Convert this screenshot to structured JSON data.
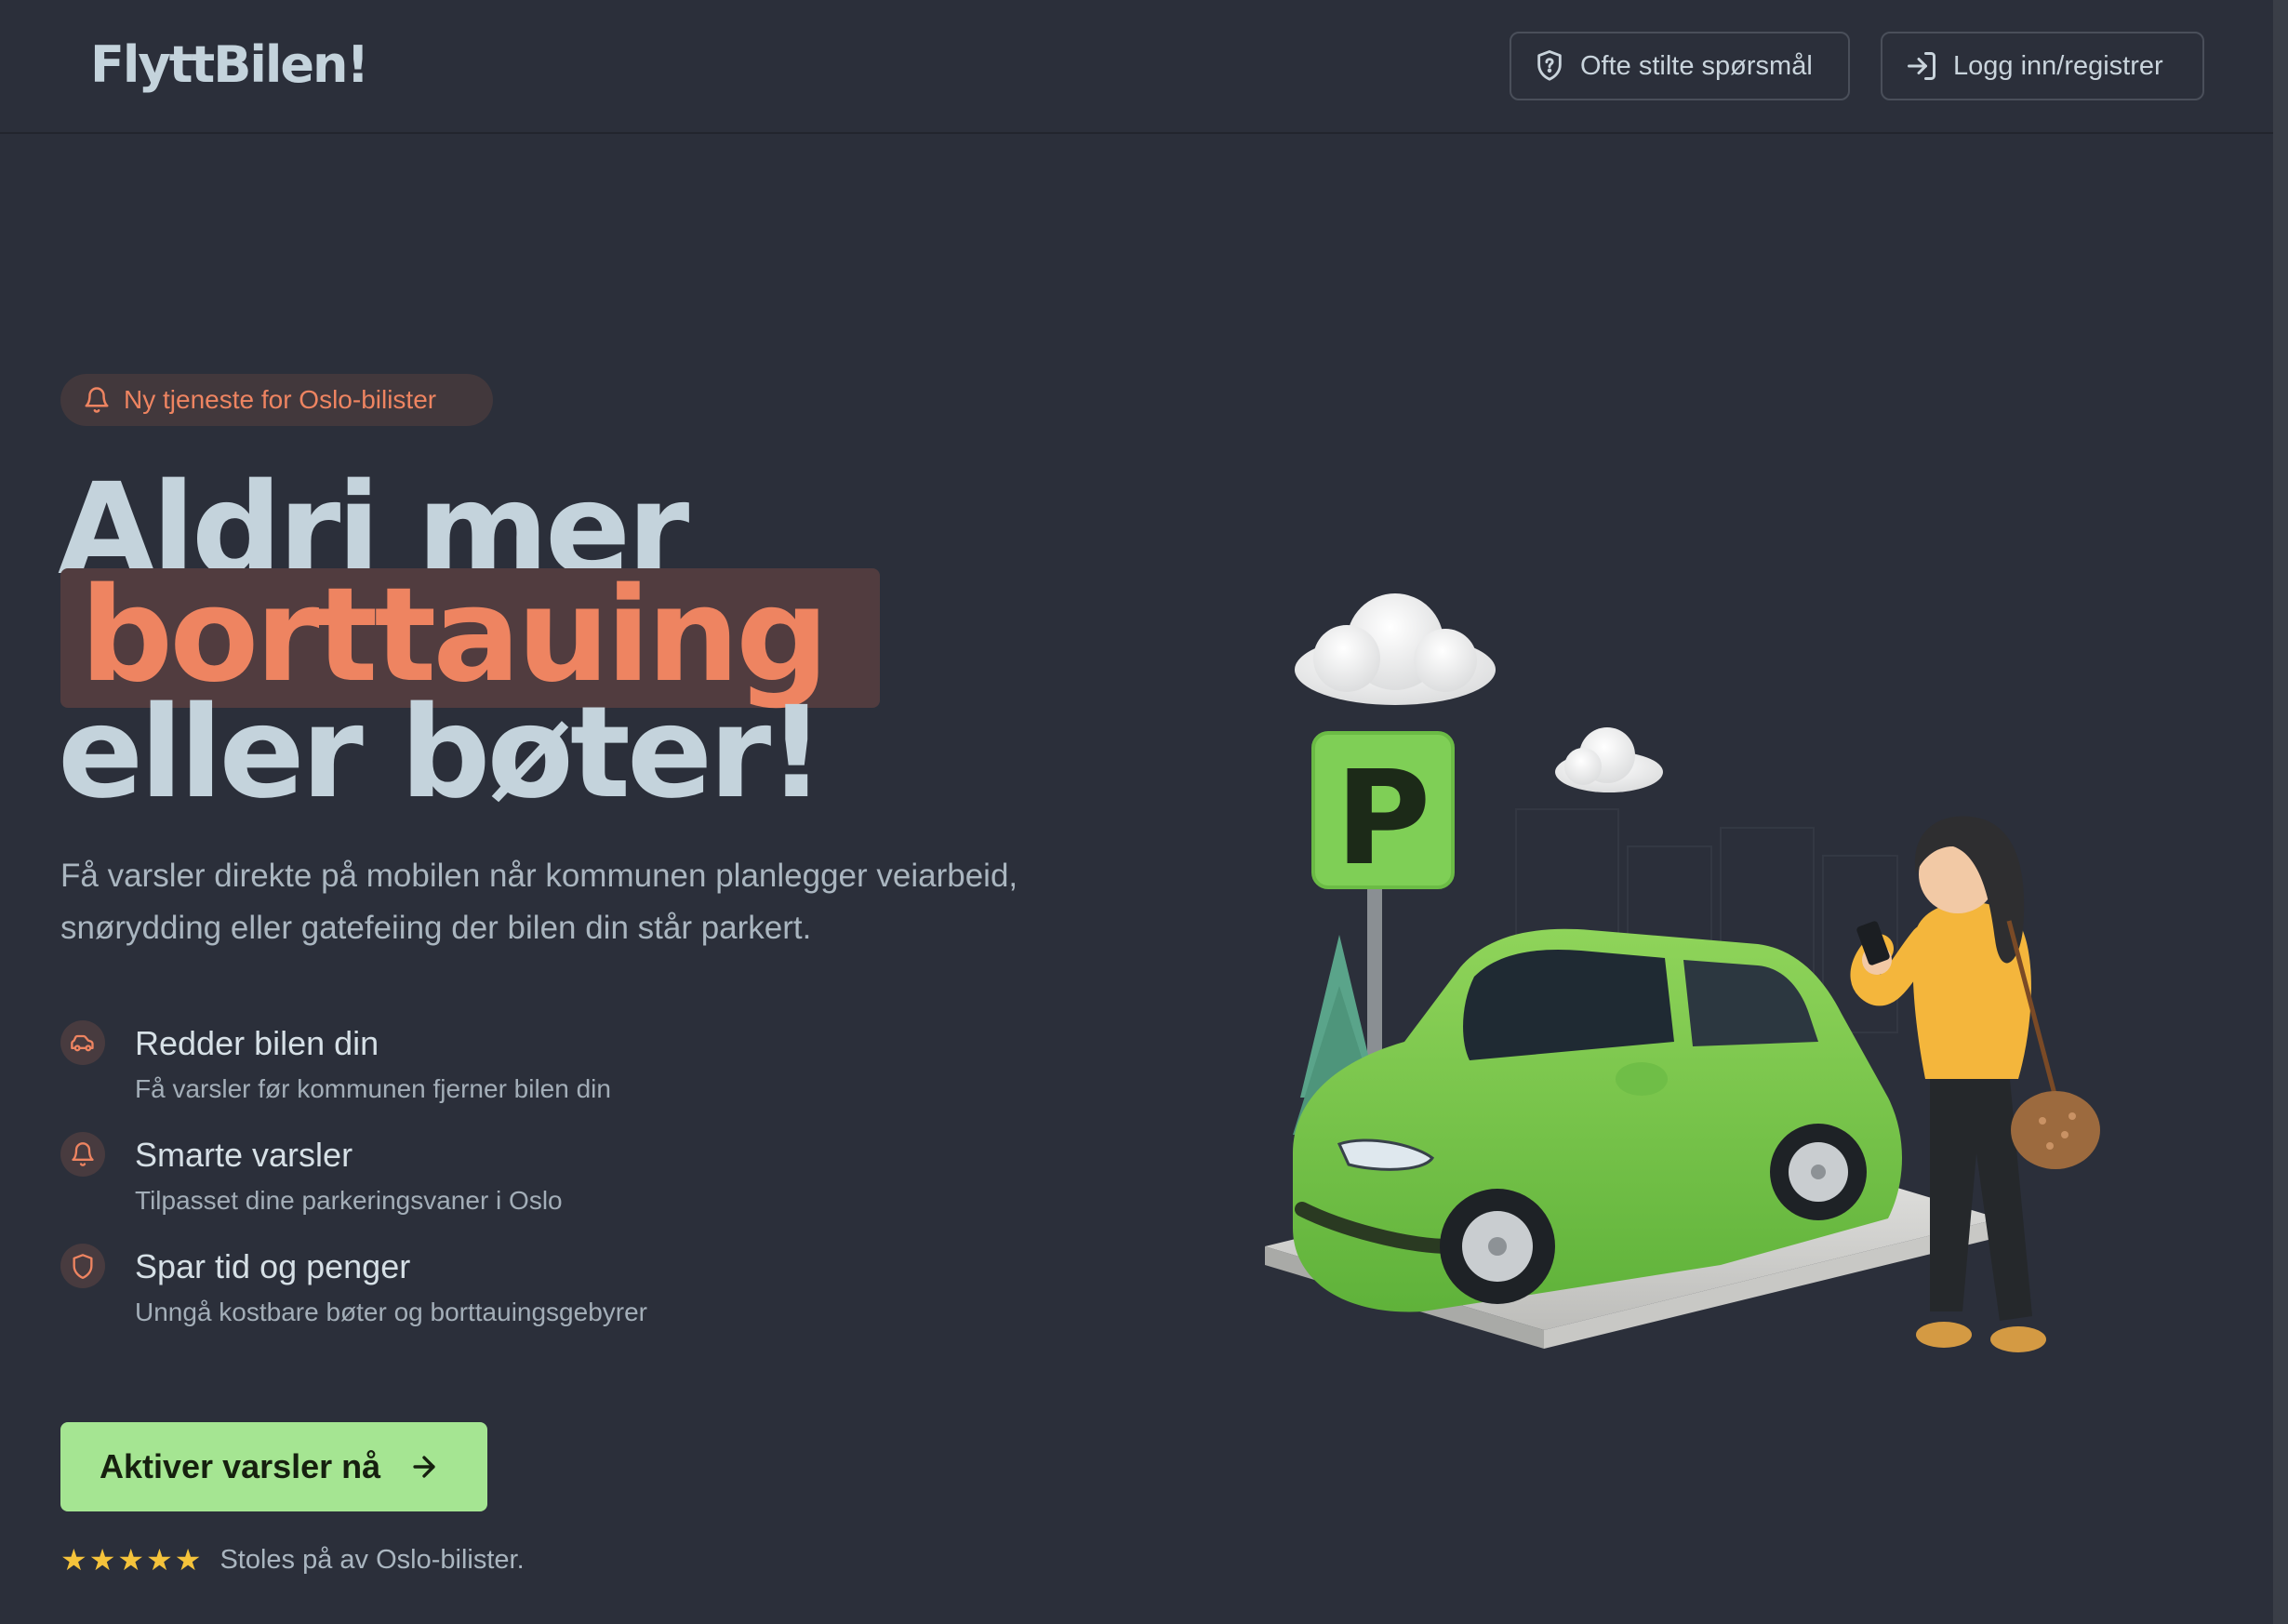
{
  "header": {
    "logo": "FlyttBilen!",
    "faq_label": "Ofte stilte spørsmål",
    "login_label": "Logg inn/registrer"
  },
  "hero": {
    "badge": "Ny tjeneste for Oslo-bilister",
    "headline_line1": "Aldri mer",
    "headline_highlight": "borttauing",
    "headline_line3": "eller bøter!",
    "lead": "Få varsler direkte på mobilen når kommunen planlegger veiarbeid, snørydding eller gatefeiing der bilen din står parkert.",
    "features": [
      {
        "icon": "car-icon",
        "title": "Redder bilen din",
        "desc": "Få varsler før kommunen fjerner bilen din"
      },
      {
        "icon": "bell-icon",
        "title": "Smarte varsler",
        "desc": "Tilpasset dine parkeringsvaner i Oslo"
      },
      {
        "icon": "shield-icon",
        "title": "Spar tid og penger",
        "desc": "Unngå kostbare bøter og borttauingsgebyrer"
      }
    ],
    "cta_label": "Aktiver varsler nå",
    "rating_stars": "★★★★★",
    "rating_text": "Stoles på av Oslo-bilister.",
    "parking_sign_letter": "P"
  },
  "colors": {
    "background": "#2b2f3a",
    "accent_orange": "#ee8461",
    "accent_green": "#a5e592",
    "text_light": "#c4d3dc",
    "star_yellow": "#f5c33b"
  }
}
